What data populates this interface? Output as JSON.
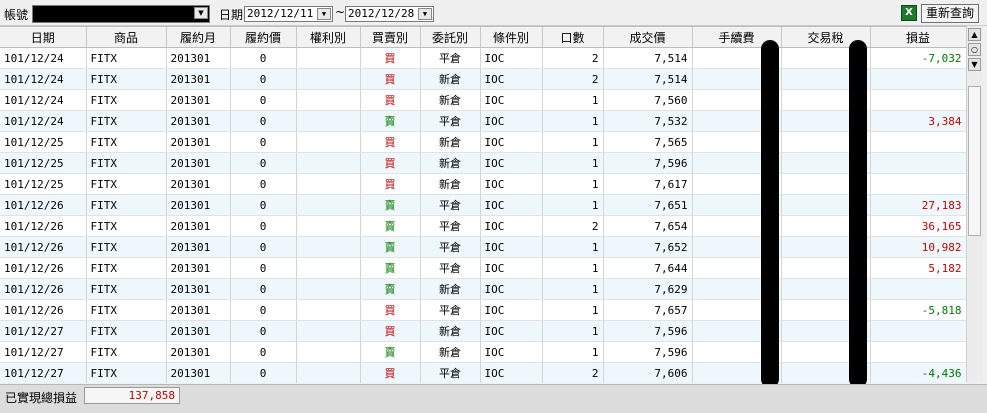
{
  "toolbar": {
    "account_label": "帳號",
    "account_value": "",
    "date_label": "日期",
    "date_from": "2012/12/11",
    "date_sep": "~",
    "date_to": "2012/12/28",
    "export_icon": "excel-icon",
    "requery_label": "重新查詢"
  },
  "columns": [
    "日期",
    "商品",
    "履約月",
    "履約價",
    "權利別",
    "買賣別",
    "委託別",
    "條件別",
    "口數",
    "成交價",
    "手續費",
    "交易稅",
    "損益"
  ],
  "rows": [
    {
      "date": "101/12/24",
      "product": "FITX",
      "month": "201301",
      "strike": "0",
      "right": "",
      "side": "買",
      "order": "平倉",
      "cond": "IOC",
      "qty": "2",
      "price": "7,514",
      "fee": "",
      "tax": "",
      "pnl": "-7,032"
    },
    {
      "date": "101/12/24",
      "product": "FITX",
      "month": "201301",
      "strike": "0",
      "right": "",
      "side": "買",
      "order": "新倉",
      "cond": "IOC",
      "qty": "2",
      "price": "7,514",
      "fee": "",
      "tax": "",
      "pnl": ""
    },
    {
      "date": "101/12/24",
      "product": "FITX",
      "month": "201301",
      "strike": "0",
      "right": "",
      "side": "買",
      "order": "新倉",
      "cond": "IOC",
      "qty": "1",
      "price": "7,560",
      "fee": "",
      "tax": "",
      "pnl": ""
    },
    {
      "date": "101/12/24",
      "product": "FITX",
      "month": "201301",
      "strike": "0",
      "right": "",
      "side": "賣",
      "order": "平倉",
      "cond": "IOC",
      "qty": "1",
      "price": "7,532",
      "fee": "",
      "tax": "",
      "pnl": "3,384"
    },
    {
      "date": "101/12/25",
      "product": "FITX",
      "month": "201301",
      "strike": "0",
      "right": "",
      "side": "買",
      "order": "新倉",
      "cond": "IOC",
      "qty": "1",
      "price": "7,565",
      "fee": "",
      "tax": "",
      "pnl": ""
    },
    {
      "date": "101/12/25",
      "product": "FITX",
      "month": "201301",
      "strike": "0",
      "right": "",
      "side": "買",
      "order": "新倉",
      "cond": "IOC",
      "qty": "1",
      "price": "7,596",
      "fee": "",
      "tax": "",
      "pnl": ""
    },
    {
      "date": "101/12/25",
      "product": "FITX",
      "month": "201301",
      "strike": "0",
      "right": "",
      "side": "買",
      "order": "新倉",
      "cond": "IOC",
      "qty": "1",
      "price": "7,617",
      "fee": "",
      "tax": "",
      "pnl": ""
    },
    {
      "date": "101/12/26",
      "product": "FITX",
      "month": "201301",
      "strike": "0",
      "right": "",
      "side": "賣",
      "order": "平倉",
      "cond": "IOC",
      "qty": "1",
      "price": "7,651",
      "fee": "",
      "tax": "",
      "pnl": "27,183"
    },
    {
      "date": "101/12/26",
      "product": "FITX",
      "month": "201301",
      "strike": "0",
      "right": "",
      "side": "賣",
      "order": "平倉",
      "cond": "IOC",
      "qty": "2",
      "price": "7,654",
      "fee": "",
      "tax": "",
      "pnl": "36,165"
    },
    {
      "date": "101/12/26",
      "product": "FITX",
      "month": "201301",
      "strike": "0",
      "right": "",
      "side": "賣",
      "order": "平倉",
      "cond": "IOC",
      "qty": "1",
      "price": "7,652",
      "fee": "",
      "tax": "",
      "pnl": "10,982"
    },
    {
      "date": "101/12/26",
      "product": "FITX",
      "month": "201301",
      "strike": "0",
      "right": "",
      "side": "賣",
      "order": "平倉",
      "cond": "IOC",
      "qty": "1",
      "price": "7,644",
      "fee": "",
      "tax": "",
      "pnl": "5,182"
    },
    {
      "date": "101/12/26",
      "product": "FITX",
      "month": "201301",
      "strike": "0",
      "right": "",
      "side": "賣",
      "order": "新倉",
      "cond": "IOC",
      "qty": "1",
      "price": "7,629",
      "fee": "",
      "tax": "",
      "pnl": ""
    },
    {
      "date": "101/12/26",
      "product": "FITX",
      "month": "201301",
      "strike": "0",
      "right": "",
      "side": "買",
      "order": "平倉",
      "cond": "IOC",
      "qty": "1",
      "price": "7,657",
      "fee": "",
      "tax": "",
      "pnl": "-5,818"
    },
    {
      "date": "101/12/27",
      "product": "FITX",
      "month": "201301",
      "strike": "0",
      "right": "",
      "side": "買",
      "order": "新倉",
      "cond": "IOC",
      "qty": "1",
      "price": "7,596",
      "fee": "",
      "tax": "",
      "pnl": ""
    },
    {
      "date": "101/12/27",
      "product": "FITX",
      "month": "201301",
      "strike": "0",
      "right": "",
      "side": "賣",
      "order": "新倉",
      "cond": "IOC",
      "qty": "1",
      "price": "7,596",
      "fee": "",
      "tax": "",
      "pnl": ""
    },
    {
      "date": "101/12/27",
      "product": "FITX",
      "month": "201301",
      "strike": "0",
      "right": "",
      "side": "買",
      "order": "平倉",
      "cond": "IOC",
      "qty": "2",
      "price": "7,606",
      "fee": "",
      "tax": "",
      "pnl": "-4,436"
    }
  ],
  "footer": {
    "total_label": "已實現總損益",
    "total_value": "137,858"
  },
  "colors": {
    "buy": "#c00000",
    "sell": "#007700",
    "profit": "#c00000",
    "loss": "#007700",
    "alt_row": "#eef7fb"
  }
}
